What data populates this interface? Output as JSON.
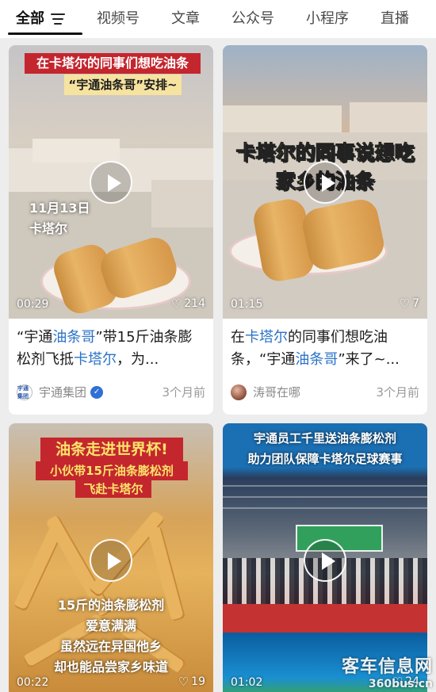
{
  "tabs": [
    {
      "label": "全部",
      "active": true
    },
    {
      "label": "视频号"
    },
    {
      "label": "文章"
    },
    {
      "label": "公众号"
    },
    {
      "label": "小程序"
    },
    {
      "label": "直播"
    }
  ],
  "cards": [
    {
      "thumb_lines": [
        "在卡塔尔的同事们想吃油条",
        "“宇通油条哥”安排~"
      ],
      "thumb_caption": [
        "11月13日",
        "卡塔尔"
      ],
      "duration": "00:29",
      "likes": "214",
      "title_parts": [
        "“宇通",
        "油条哥",
        "”带15斤油条膨松剂飞抵",
        "卡塔尔",
        "，为..."
      ],
      "author": "宇通集团",
      "author_avatar_text": "宇通集团",
      "verified": true,
      "time": "3个月前"
    },
    {
      "thumb_lines": [
        "卡塔尔的同事说想吃",
        "家乡的油条"
      ],
      "duration": "01:15",
      "likes": "7",
      "title_parts": [
        "在",
        "卡塔尔",
        "的同事们想吃油条，“宇通",
        "油条哥",
        "”来了~..."
      ],
      "author": "涛哥在哪",
      "time": "3个月前"
    },
    {
      "thumb_lines": [
        "油条走进世界杯!",
        "小伙带15斤油条膨松剂",
        "飞赴卡塔尔"
      ],
      "thumb_caption": [
        "15斤的油条膨松剂",
        "爱意满满",
        "虽然远在异国他乡",
        "却也能品尝家乡味道"
      ],
      "duration": "00:22",
      "likes": "19"
    },
    {
      "thumb_lines": [
        "宇通员工千里送油条膨松剂",
        "助力团队保障卡塔尔足球赛事"
      ],
      "duration": "01:02",
      "likes": "24"
    }
  ],
  "watermark": {
    "line1": "客车信息网",
    "line2": "360bus.cn"
  },
  "colors": {
    "link": "#2a72c8",
    "accent_red": "#c4262e",
    "verified": "#2f6fd6"
  }
}
